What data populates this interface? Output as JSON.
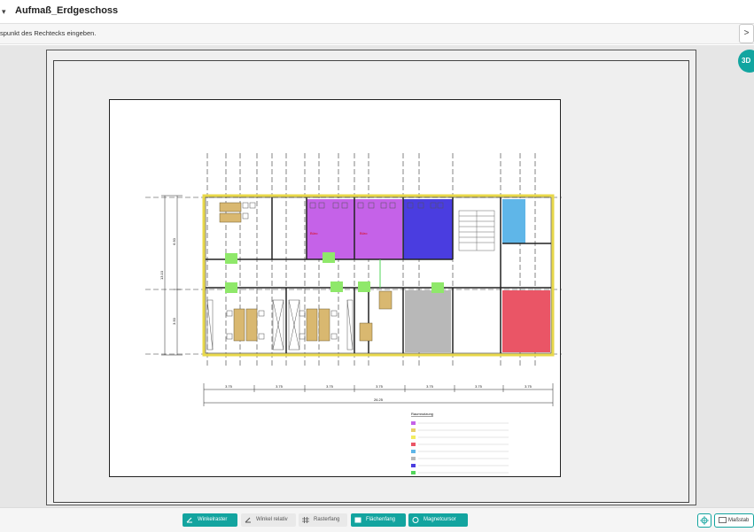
{
  "app": {
    "title": "Aufmaß_Erdgeschoss"
  },
  "prompt": {
    "text": "spunkt des Rechtecks eingeben.",
    "next_arrow": ">"
  },
  "view_toggle": {
    "label": "3D"
  },
  "plan": {
    "rooms": [
      {
        "label": "Büro",
        "color": "#c562e8"
      },
      {
        "label": "Büro",
        "color": "#c562e8"
      },
      {
        "label": "",
        "color": "#4a3de0"
      },
      {
        "label": "",
        "color": "#5fb6e8"
      },
      {
        "label": "",
        "color": "#ea5566"
      },
      {
        "label": "",
        "color": "#b8b8b8"
      }
    ],
    "dim_bottom": [
      "3.75",
      "3.75",
      "3.75",
      "3.75",
      "3.75",
      "3.75",
      "3.75"
    ],
    "dim_total": "26.25",
    "dim_left": [
      "6.50",
      "3.50"
    ],
    "dim_left_total": "13.10",
    "legend_title": "Raumnutzung",
    "legend_colors": [
      "#c562e8",
      "#e8cf6a",
      "#f3ec60",
      "#ea5566",
      "#5fb6e8",
      "#b8b8b8",
      "#4a3de0",
      "#52d65a"
    ]
  },
  "toolbar": {
    "tools": [
      {
        "label": "Winkelraster",
        "active": true
      },
      {
        "label": "Winkel relativ",
        "active": false
      },
      {
        "label": "Rasterfang",
        "active": false
      },
      {
        "label": "Flächenfang",
        "active": true
      },
      {
        "label": "Magnetcursor",
        "active": true
      }
    ],
    "scale_label": "Maßstab"
  },
  "colors": {
    "accent": "#13a49f",
    "wall": "#e8d84a",
    "furniture": "#d9b870"
  }
}
